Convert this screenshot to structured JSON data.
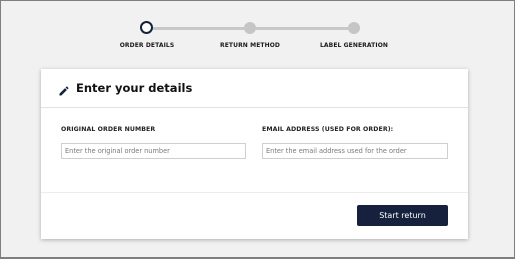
{
  "stepper": {
    "steps": [
      {
        "label": "ORDER DETAILS",
        "state": "active"
      },
      {
        "label": "RETURN METHOD",
        "state": "inactive"
      },
      {
        "label": "LABEL GENERATION",
        "state": "inactive"
      }
    ]
  },
  "card": {
    "title": "Enter your details",
    "title_icon": "pencil-icon"
  },
  "form": {
    "order_number_label": "ORIGINAL ORDER NUMBER",
    "order_number_placeholder": "Enter the original order number",
    "order_number_value": "",
    "email_label": "EMAIL ADDRESS (USED FOR ORDER):",
    "email_placeholder": "Enter the email address used for the order",
    "email_value": ""
  },
  "actions": {
    "start_return_label": "Start return"
  },
  "colors": {
    "brand": "#15213d",
    "inactive_step": "#c5c5c5",
    "background": "#f1f1f1"
  }
}
